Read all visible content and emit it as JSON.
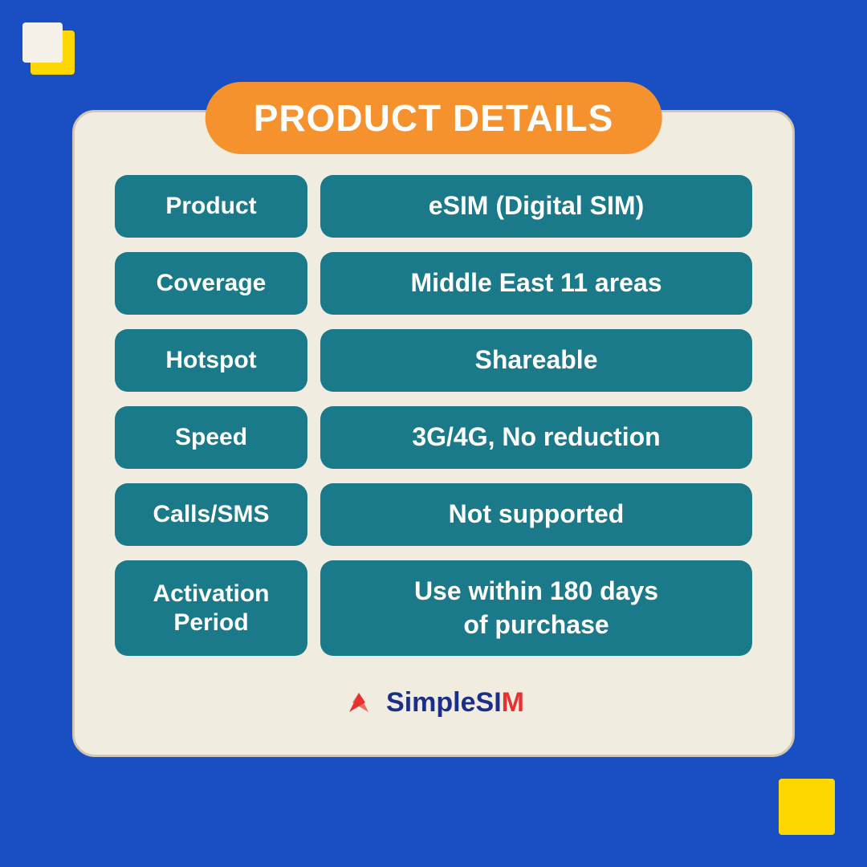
{
  "page": {
    "background_color": "#1a4fc4",
    "title_badge": {
      "text": "PRODUCT DETAILS",
      "color": "#f5922e"
    },
    "rows": [
      {
        "label": "Product",
        "value": "eSIM (Digital SIM)"
      },
      {
        "label": "Coverage",
        "value": "Middle East 11 areas"
      },
      {
        "label": "Hotspot",
        "value": "Shareable"
      },
      {
        "label": "Speed",
        "value": "3G/4G, No reduction"
      },
      {
        "label": "Calls/SMS",
        "value": "Not supported"
      },
      {
        "label": "Activation\nPeriod",
        "value": "Use within 180 days\nof purchase"
      }
    ],
    "brand": {
      "name_part1": "SimpleSI",
      "name_part2": "M"
    }
  }
}
